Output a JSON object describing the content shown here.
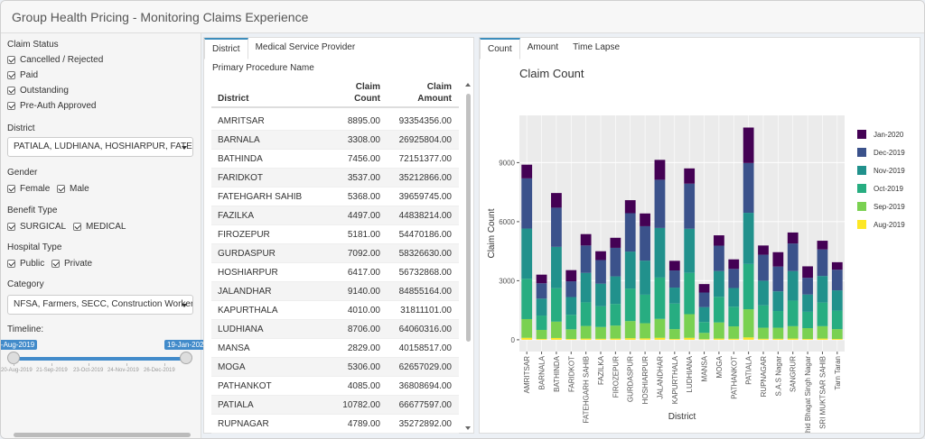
{
  "app": {
    "title": "Group Health Pricing - Monitoring Claims Experience"
  },
  "sidebar": {
    "claim_status": {
      "label": "Claim Status",
      "options": [
        "Cancelled / Rejected",
        "Paid",
        "Outstanding",
        "Pre-Auth Approved"
      ]
    },
    "district": {
      "label": "District",
      "selected": "PATIALA, LUDHIANA, HOSHIARPUR, FATEH"
    },
    "gender": {
      "label": "Gender",
      "options": [
        "Female",
        "Male"
      ]
    },
    "benefit_type": {
      "label": "Benefit Type",
      "options": [
        "SURGICAL",
        "MEDICAL"
      ]
    },
    "hospital_type": {
      "label": "Hospital Type",
      "options": [
        "Public",
        "Private"
      ]
    },
    "category": {
      "label": "Category",
      "selected": "NFSA, Farmers, SECC, Construction Workers"
    },
    "timeline": {
      "label": "Timeline:",
      "start": "20-Aug-2019",
      "end": "19-Jan-2020",
      "ticks": [
        "20-Aug-2019",
        "21-Sep-2019",
        "23-Oct-2019",
        "24-Nov-2019",
        "26-Dec-2019"
      ]
    }
  },
  "middle": {
    "tabs": [
      "District",
      "Medical Service Provider"
    ],
    "subtab": "Primary Procedure Name",
    "columns": {
      "district": "District",
      "count_1": "Claim",
      "count_2": "Count",
      "amount_1": "Claim",
      "amount_2": "Amount"
    },
    "rows": [
      {
        "district": "AMRITSAR",
        "count": "8895.00",
        "amount": "93354356.00"
      },
      {
        "district": "BARNALA",
        "count": "3308.00",
        "amount": "26925804.00"
      },
      {
        "district": "BATHINDA",
        "count": "7456.00",
        "amount": "72151377.00"
      },
      {
        "district": "FARIDKOT",
        "count": "3537.00",
        "amount": "35212866.00"
      },
      {
        "district": "FATEHGARH SAHIB",
        "count": "5368.00",
        "amount": "39659745.00"
      },
      {
        "district": "FAZILKA",
        "count": "4497.00",
        "amount": "44838214.00"
      },
      {
        "district": "FIROZEPUR",
        "count": "5181.00",
        "amount": "54470186.00"
      },
      {
        "district": "GURDASPUR",
        "count": "7092.00",
        "amount": "58326630.00"
      },
      {
        "district": "HOSHIARPUR",
        "count": "6417.00",
        "amount": "56732868.00"
      },
      {
        "district": "JALANDHAR",
        "count": "9140.00",
        "amount": "84855164.00"
      },
      {
        "district": "KAPURTHALA",
        "count": "4010.00",
        "amount": "31811101.00"
      },
      {
        "district": "LUDHIANA",
        "count": "8706.00",
        "amount": "64060316.00"
      },
      {
        "district": "MANSA",
        "count": "2829.00",
        "amount": "40158517.00"
      },
      {
        "district": "MOGA",
        "count": "5306.00",
        "amount": "62657029.00"
      },
      {
        "district": "PATHANKOT",
        "count": "4085.00",
        "amount": "36808694.00"
      },
      {
        "district": "PATIALA",
        "count": "10782.00",
        "amount": "66677597.00"
      },
      {
        "district": "RUPNAGAR",
        "count": "4789.00",
        "amount": "35272892.00"
      }
    ]
  },
  "right": {
    "tabs": [
      "Count",
      "Amount",
      "Time Lapse"
    ],
    "legend_colors": [
      "#440154",
      "#3b528b",
      "#21918c",
      "#27ad81",
      "#7ad151",
      "#fde725"
    ]
  },
  "chart_data": {
    "type": "bar",
    "title": "Claim Count",
    "xlabel": "District",
    "ylabel": "Claim Count",
    "ylim": [
      -600,
      11400
    ],
    "yticks": [
      0,
      3000,
      6000,
      9000
    ],
    "ytick_labels": [
      "0",
      "3000",
      "6000",
      "9000"
    ],
    "legend_position": "right",
    "categories": [
      "AMRITSAR",
      "BARNALA",
      "BATHINDA",
      "FARIDKOT",
      "FATEHGARH SAHIB",
      "FAZILKA",
      "FIROZEPUR",
      "GURDASPUR",
      "HOSHIARPUR",
      "JALANDHAR",
      "KAPURTHALA",
      "LUDHIANA",
      "MANSA",
      "MOGA",
      "PATHANKOT",
      "PATIALA",
      "RUPNAGAR",
      "S.A.S Nagar",
      "SANGRUR",
      "Shahid Bhagat Singh Nagar",
      "SRI MUKTSAR SAHIB",
      "Tarn Taran"
    ],
    "series": [
      {
        "name": "Aug-2019",
        "values": [
          100,
          40,
          90,
          40,
          60,
          50,
          60,
          80,
          70,
          100,
          40,
          100,
          30,
          60,
          50,
          120,
          50,
          50,
          60,
          40,
          60,
          40
        ]
      },
      {
        "name": "Sep-2019",
        "values": [
          950,
          460,
          830,
          490,
          640,
          600,
          660,
          870,
          770,
          960,
          500,
          1200,
          320,
          820,
          630,
          1430,
          560,
          560,
          630,
          550,
          630,
          500
        ]
      },
      {
        "name": "Oct-2019",
        "values": [
          2050,
          730,
          1700,
          740,
          1200,
          1050,
          1100,
          1650,
          1450,
          2100,
          1300,
          2100,
          550,
          1300,
          1000,
          2300,
          1140,
          850,
          1300,
          830,
          1200,
          940
        ]
      },
      {
        "name": "Nov-2019",
        "values": [
          2550,
          860,
          2100,
          900,
          1500,
          1150,
          1400,
          1880,
          1730,
          2520,
          810,
          2240,
          760,
          1310,
          950,
          2600,
          1250,
          1000,
          1500,
          880,
          1350,
          1030
        ]
      },
      {
        "name": "Dec-2019",
        "values": [
          2550,
          780,
          1990,
          800,
          1390,
          1200,
          1450,
          1950,
          1750,
          2450,
          870,
          2290,
          740,
          1290,
          970,
          2530,
          1320,
          1260,
          1400,
          850,
          1350,
          1050
        ]
      },
      {
        "name": "Jan-2020",
        "values": [
          695,
          438,
          746,
          567,
          578,
          447,
          511,
          662,
          647,
          1010,
          490,
          776,
          429,
          526,
          485,
          1802,
          469,
          730,
          560,
          580,
          441,
          380
        ]
      }
    ]
  }
}
